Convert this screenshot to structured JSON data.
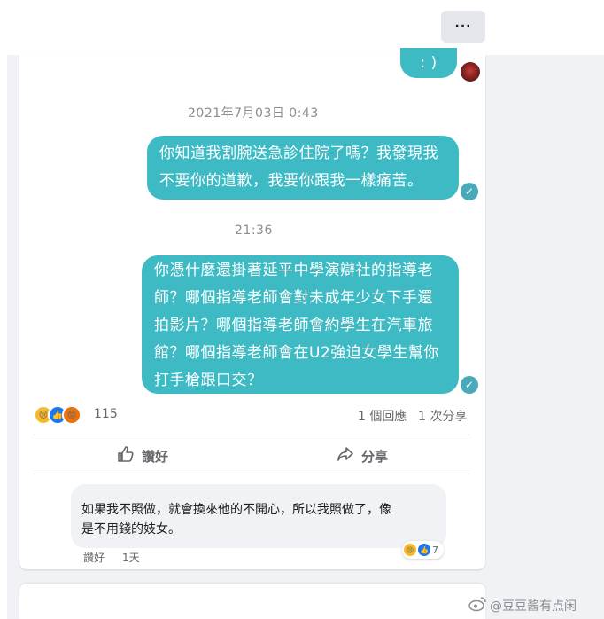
{
  "header": {
    "more_label": "···"
  },
  "chat": {
    "top_bubble_text": ": )",
    "timestamp1": "2021年7月03日 0:43",
    "message1": "你知道我割腕送急診住院了嗎？我發現我\n不要你的道歉，我要你跟我一樣痛苦。",
    "timestamp2": "21:36",
    "message2": "你憑什麼還掛著延平中學演辯社的指導老\n師？哪個指導老師會對未成年少女下手還\n拍影片？哪個指導老師會約學生在汽車旅\n館？哪個指導老師會在U2強迫女學生幫你\n打手槍跟口交？"
  },
  "post_stats": {
    "reactions_count": "115",
    "comments": "1 個回應",
    "shares": "1 次分享"
  },
  "actions": {
    "like_label": "讚好",
    "share_label": "分享"
  },
  "comment": {
    "text": "如果我不照做，就會換來他的不開心，所以我照做了，像\n是不用錢的妓女。",
    "like_label": "讚好",
    "time": "1天",
    "reaction_count": "7"
  },
  "watermark": {
    "text": "@豆豆酱有点闲"
  },
  "colors": {
    "bubble": "#3ebac4",
    "check": "#4aa9b8",
    "like_blue": "#1877f2",
    "angry": "#e9710f"
  }
}
